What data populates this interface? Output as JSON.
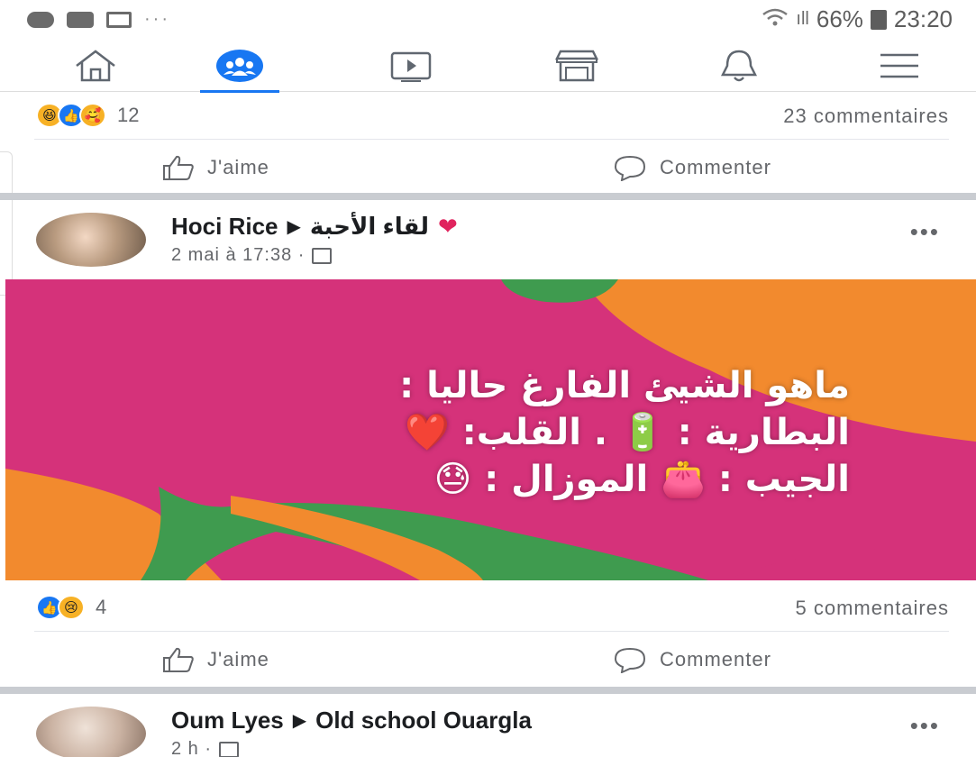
{
  "status_bar": {
    "battery": "66%",
    "time": "23:20",
    "signal": "ıll",
    "extra": "···"
  },
  "nav": {
    "items": [
      {
        "name": "home",
        "icon": "home-icon"
      },
      {
        "name": "groups",
        "icon": "groups-icon",
        "active": true
      },
      {
        "name": "watch",
        "icon": "video-icon"
      },
      {
        "name": "marketplace",
        "icon": "store-icon"
      },
      {
        "name": "notifications",
        "icon": "bell-icon"
      },
      {
        "name": "menu",
        "icon": "hamburger-icon"
      }
    ]
  },
  "post1": {
    "reaction_count": "12",
    "comments": "23 commentaires",
    "like_label": "J'aime",
    "comment_label": "Commenter"
  },
  "post2": {
    "author": "Hoci Rice",
    "group": "لقاء الأحبة",
    "heart": "❤",
    "timestamp": "2 mai à 17:38 ·",
    "more": "•••",
    "image_text": {
      "line1": "ماهو  الشيئ الفارغ حاليا :",
      "line2": "البطارية : 🔋 .  القلب: ❤️",
      "line3": "الجيب : 👛  الموزال : 😓"
    },
    "reaction_count": "4",
    "comments": "5 commentaires",
    "like_label": "J'aime",
    "comment_label": "Commenter"
  },
  "post3": {
    "author": "Oum Lyes",
    "group": "Old school Ouargla",
    "timestamp": "2 h ·",
    "more": "•••"
  },
  "colors": {
    "accent": "#1877f2",
    "magenta": "#d5327a",
    "orange": "#f28a2e",
    "green": "#3f9b4f"
  }
}
